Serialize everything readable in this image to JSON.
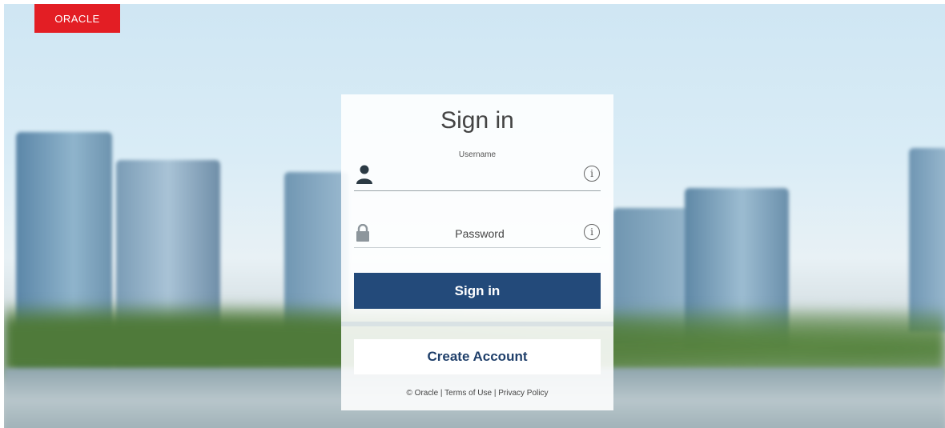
{
  "brand": {
    "logo_text": "ORACLE",
    "color": "#e31e24"
  },
  "form": {
    "title": "Sign in",
    "username_label": "Username",
    "username_value": "",
    "password_placeholder": "Password",
    "info_glyph": "i",
    "signin_button": "Sign in",
    "create_account_button": "Create Account",
    "accent_color": "#234a7a"
  },
  "footer": {
    "copyright": "© Oracle",
    "separator": "|",
    "terms": "Terms of Use",
    "privacy": "Privacy Policy"
  }
}
